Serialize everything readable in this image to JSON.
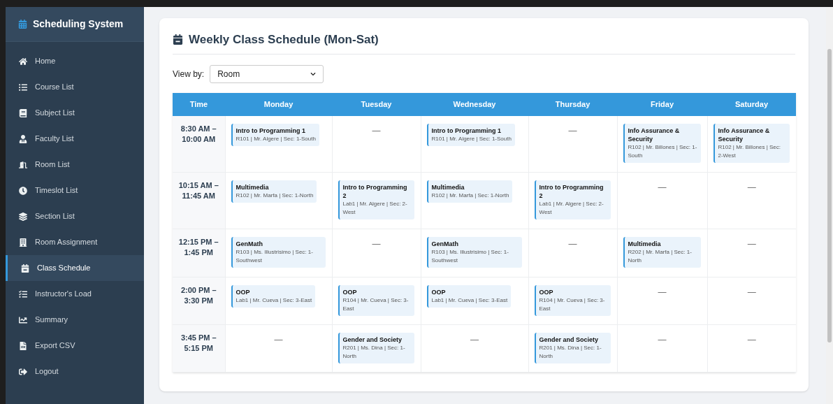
{
  "sidebar": {
    "title": "Scheduling System",
    "items": [
      {
        "label": "Home",
        "selected": false
      },
      {
        "label": "Course List",
        "selected": false
      },
      {
        "label": "Subject List",
        "selected": false
      },
      {
        "label": "Faculty List",
        "selected": false
      },
      {
        "label": "Room List",
        "selected": false
      },
      {
        "label": "Timeslot List",
        "selected": false
      },
      {
        "label": "Section List",
        "selected": false
      },
      {
        "label": "Room Assignment",
        "selected": false
      },
      {
        "label": "Class Schedule",
        "selected": true
      },
      {
        "label": "Instructor's Load",
        "selected": false
      },
      {
        "label": "Summary",
        "selected": false
      },
      {
        "label": "Export CSV",
        "selected": false
      },
      {
        "label": "Logout",
        "selected": false
      }
    ]
  },
  "page": {
    "title": "Weekly Class Schedule (Mon-Sat)",
    "view_by": {
      "label": "View by:",
      "value": "Room"
    }
  },
  "table": {
    "columns": [
      "Time",
      "Monday",
      "Tuesday",
      "Wednesday",
      "Thursday",
      "Friday",
      "Saturday"
    ],
    "rows": [
      {
        "cells": [
          {
            "kind": "time",
            "text": "8:30 AM – 10:00 AM"
          },
          {
            "kind": "class",
            "title": "Intro to Programming 1",
            "detail": "R101 | Mr. Algere | Sec: 1-South"
          },
          {
            "kind": "empty",
            "text": "—"
          },
          {
            "kind": "class",
            "title": "Intro to Programming 1",
            "detail": "R101 | Mr. Algere | Sec: 1-South"
          },
          {
            "kind": "empty",
            "text": "—"
          },
          {
            "kind": "class",
            "title": "Info Assurance & Security",
            "detail": "R102 | Mr. Billones | Sec: 1-South"
          },
          {
            "kind": "class",
            "title": "Info Assurance & Security",
            "detail": "R102 | Mr. Billones | Sec: 2-West"
          }
        ]
      },
      {
        "cells": [
          {
            "kind": "time",
            "text": "10:15 AM – 11:45 AM"
          },
          {
            "kind": "class",
            "title": "Multimedia",
            "detail": "R102 | Mr. Marfa | Sec: 1-North"
          },
          {
            "kind": "class",
            "title": "Intro to Programming 2",
            "detail": "Lab1 | Mr. Algere | Sec: 2-West"
          },
          {
            "kind": "class",
            "title": "Multimedia",
            "detail": "R102 | Mr. Marfa | Sec: 1-North"
          },
          {
            "kind": "class",
            "title": "Intro to Programming 2",
            "detail": "Lab1 | Mr. Algere | Sec: 2-West"
          },
          {
            "kind": "empty",
            "text": "—"
          },
          {
            "kind": "empty",
            "text": "—"
          }
        ]
      },
      {
        "cells": [
          {
            "kind": "time",
            "text": "12:15 PM – 1:45 PM"
          },
          {
            "kind": "class",
            "title": "GenMath",
            "detail": "R103 | Ms. Illustrisimo | Sec: 1-Southwest"
          },
          {
            "kind": "empty",
            "text": "—"
          },
          {
            "kind": "class",
            "title": "GenMath",
            "detail": "R103 | Ms. Illustrisimo | Sec: 1-Southwest"
          },
          {
            "kind": "empty",
            "text": "—"
          },
          {
            "kind": "class",
            "title": "Multimedia",
            "detail": "R202 | Mr. Marfa | Sec: 1-North"
          },
          {
            "kind": "empty",
            "text": "—"
          }
        ]
      },
      {
        "cells": [
          {
            "kind": "time",
            "text": "2:00 PM – 3:30 PM"
          },
          {
            "kind": "class",
            "title": "OOP",
            "detail": "Lab1 | Mr. Cueva | Sec: 3-East"
          },
          {
            "kind": "class",
            "title": "OOP",
            "detail": "R104 | Mr. Cueva | Sec: 3-East"
          },
          {
            "kind": "class",
            "title": "OOP",
            "detail": "Lab1 | Mr. Cueva | Sec: 3-East"
          },
          {
            "kind": "class",
            "title": "OOP",
            "detail": "R104 | Mr. Cueva | Sec: 3-East"
          },
          {
            "kind": "empty",
            "text": "—"
          },
          {
            "kind": "empty",
            "text": "—"
          }
        ]
      },
      {
        "cells": [
          {
            "kind": "time",
            "text": "3:45 PM – 5:15 PM"
          },
          {
            "kind": "empty",
            "text": "—"
          },
          {
            "kind": "class",
            "title": "Gender and Society",
            "detail": "R201 | Ms. Dina | Sec: 1-North"
          },
          {
            "kind": "empty",
            "text": "—"
          },
          {
            "kind": "class",
            "title": "Gender and Society",
            "detail": "R201 | Ms. Dina | Sec: 1-North"
          },
          {
            "kind": "empty",
            "text": "—"
          },
          {
            "kind": "empty",
            "text": "—"
          }
        ]
      }
    ]
  }
}
